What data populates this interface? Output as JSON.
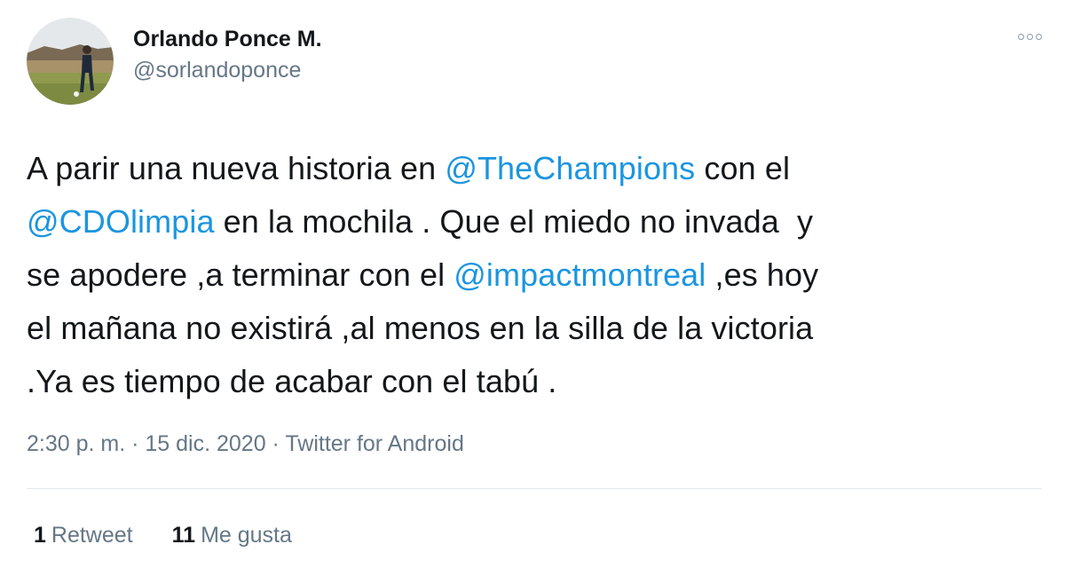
{
  "author": {
    "display_name": "Orlando Ponce M.",
    "handle": "@sorlandoponce",
    "avatar_icon": "profile-photo-icon"
  },
  "more_icon": "more-options-icon",
  "tweet": {
    "line1": {
      "t1": "A parir una nueva historia en ",
      "m1": "@TheChampions",
      "t2": " con el"
    },
    "line2": {
      "m1": "@CDOlimpia",
      "t1": " en la mochila . Que el miedo no invada  y"
    },
    "line3": {
      "t1": "se apodere ,a terminar con el ",
      "m1": "@impactmontreal",
      "t2": " ,es hoy"
    },
    "line4": "el mañana no existirá ,al menos en la silla de la victoria",
    "line5": ".Ya es tiempo de acabar con el tabú ."
  },
  "meta": {
    "time": "2:30 p. m.",
    "separator": " · ",
    "date": "15 dic. 2020",
    "source": "Twitter for Android"
  },
  "stats": {
    "retweets_count": "1",
    "retweets_label": "Retweet",
    "likes_count": "11",
    "likes_label": "Me gusta"
  },
  "colors": {
    "mention": "#1b95e0",
    "text": "#14171a",
    "secondary": "#657786",
    "divider": "#e1e8ed"
  }
}
